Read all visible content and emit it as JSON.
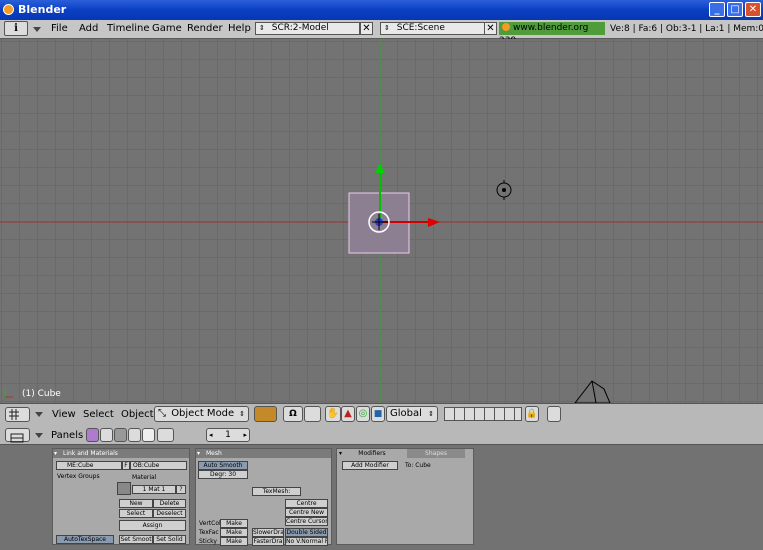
{
  "window": {
    "title": "Blender",
    "minimize": "_",
    "maximize": "□",
    "close": "✕"
  },
  "topbar": {
    "menus": [
      "File",
      "Add",
      "Timeline",
      "Game",
      "Render",
      "Help"
    ],
    "screen_field": "SCR:2-Model",
    "scene_field": "SCE:Scene",
    "url": "www.blender.org 239",
    "stats": "Ve:8 | Fa:6 | Ob:3-1 | La:1 | Mem:0"
  },
  "viewport": {
    "object_label": "(1) Cube"
  },
  "header3d": {
    "view": "View",
    "select": "Select",
    "object": "Object",
    "mode": "Object Mode",
    "orientation": "Global"
  },
  "buttons_header": {
    "panels": "Panels",
    "frame": "1"
  },
  "link_panel": {
    "title": "Link and Materials",
    "mesh_field": "ME:Cube",
    "f_label": "F",
    "ob_field": "OB:Cube",
    "vertex_groups": "Vertex Groups",
    "material": "Material",
    "mat_field": "1 Mat 1",
    "new": "New",
    "delete": "Delete",
    "select": "Select",
    "deselect": "Deselect",
    "assign": "Assign",
    "autotexspace": "AutoTexSpace",
    "set_smooth": "Set Smoot",
    "set_solid": "Set Solid"
  },
  "mesh_panel": {
    "title": "Mesh",
    "auto_smooth": "Auto Smooth",
    "degr": "Degr: 30",
    "texmesh": "TexMesh:",
    "centre": "Centre",
    "centre_new": "Centre New",
    "centre_cursor": "Centre Cursor",
    "vertcol": "VertCol",
    "texface": "TexFac",
    "sticky": "Sticky",
    "make": "Make",
    "slower": "SlowerDra",
    "faster": "FasterDra",
    "double_sided": "Double Sided",
    "no_vnormal": "No V.Normal Fl"
  },
  "modifiers_panel": {
    "tab_modifiers": "Modifiers",
    "tab_shapes": "Shapes",
    "add_modifier": "Add Modifier",
    "to": "To: Cube"
  }
}
